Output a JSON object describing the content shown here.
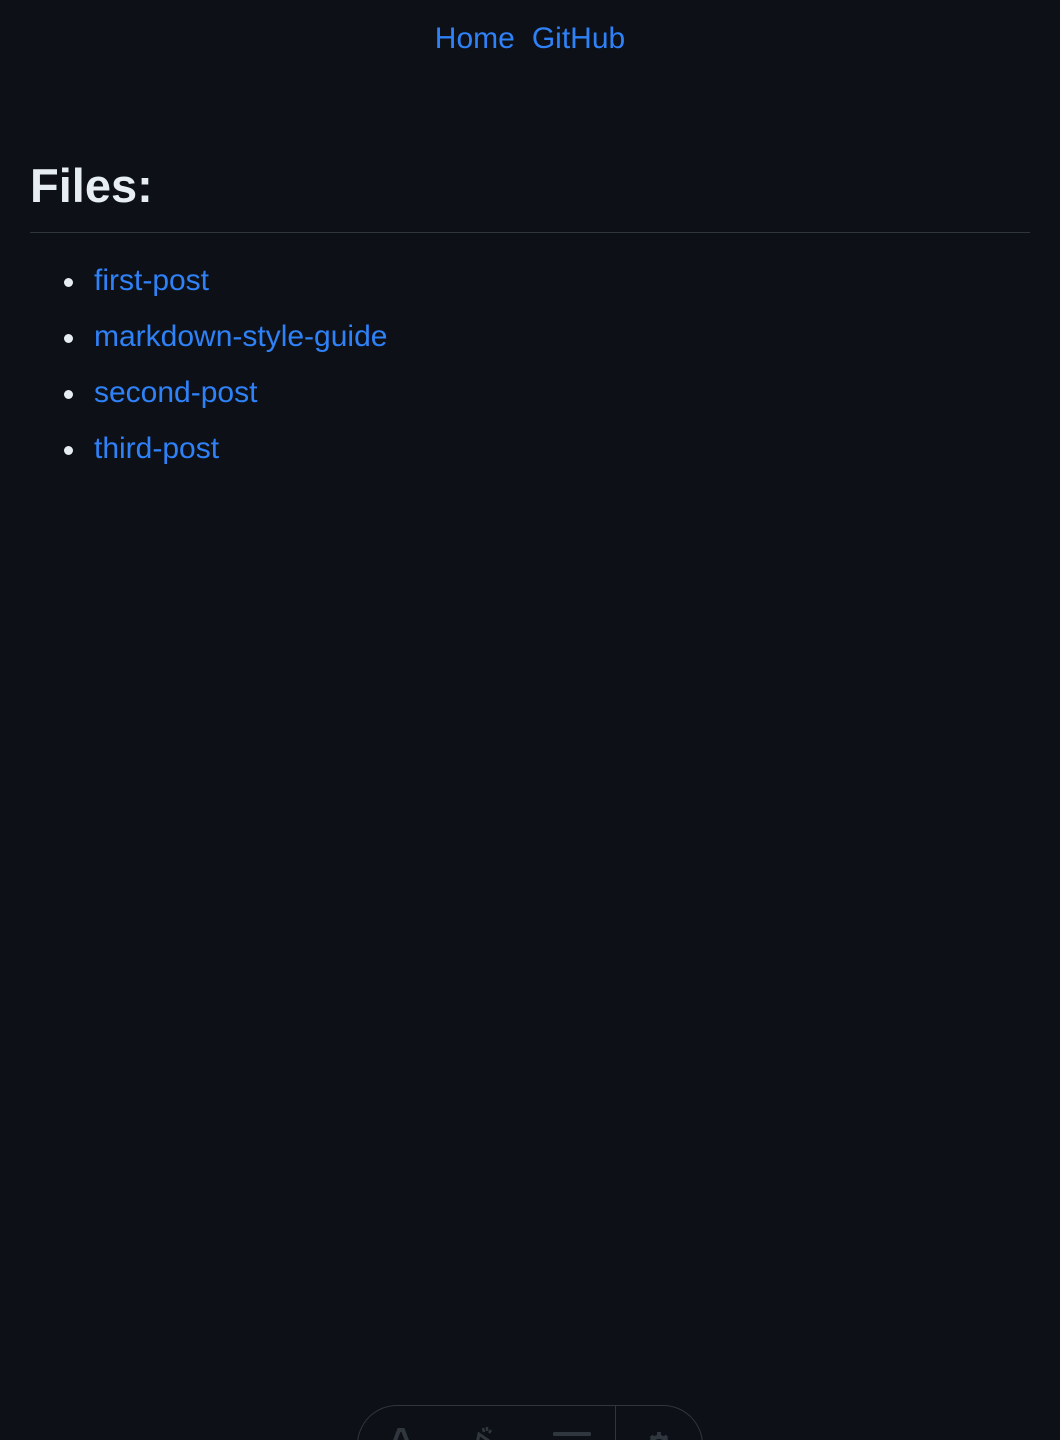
{
  "nav": {
    "home_label": "Home",
    "github_label": "GitHub"
  },
  "main": {
    "heading": "Files:",
    "files": [
      {
        "label": "first-post"
      },
      {
        "label": "markdown-style-guide"
      },
      {
        "label": "second-post"
      },
      {
        "label": "third-post"
      }
    ]
  },
  "toolbar": {
    "icons": [
      "font-icon",
      "rocket-icon",
      "menu-icon",
      "gear-icon"
    ]
  },
  "colors": {
    "background": "#0d1117",
    "link": "#2f81f7",
    "heading": "#e6edf3",
    "divider": "#30363d"
  }
}
